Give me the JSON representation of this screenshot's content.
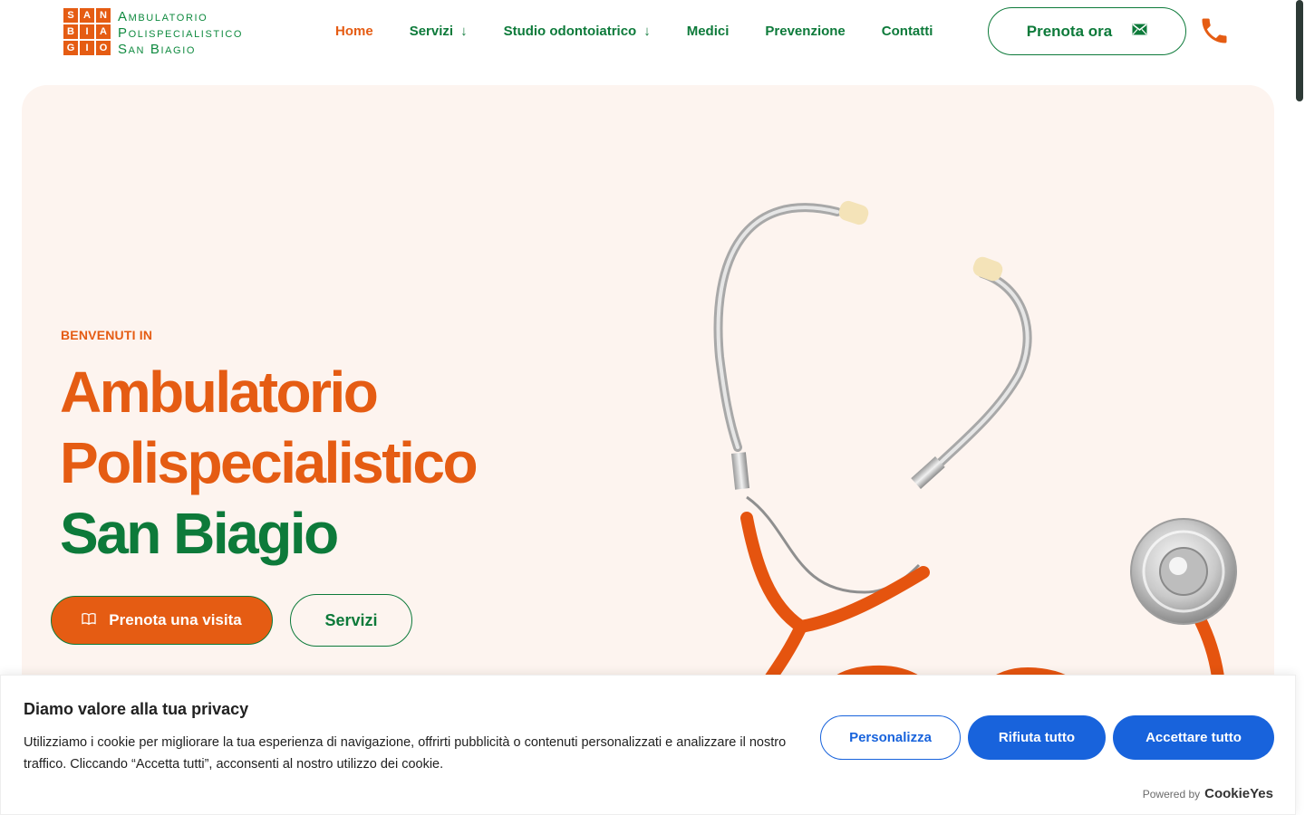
{
  "logo": {
    "grid": [
      "S",
      "A",
      "N",
      "B",
      "I",
      "A",
      "G",
      "I",
      "O"
    ],
    "lines": [
      "Ambulatorio",
      "Polispecialistico",
      "San Biagio"
    ]
  },
  "nav": {
    "items": [
      {
        "label": "Home",
        "active": true
      },
      {
        "label": "Servizi",
        "has_dropdown": true
      },
      {
        "label": "Studio odontoiatrico",
        "has_dropdown": true
      },
      {
        "label": "Medici"
      },
      {
        "label": "Prevenzione"
      },
      {
        "label": "Contatti"
      }
    ],
    "book_label": "Prenota ora",
    "book_icon": "envelope-icon",
    "phone_icon": "phone-icon"
  },
  "hero": {
    "eyebrow": "BENVENUTI IN",
    "title_line1": "Ambulatorio",
    "title_line2": "Polispecialistico",
    "title_line3": "San Biagio",
    "primary_button": "Prenota una visita",
    "primary_icon": "book-icon",
    "secondary_button": "Servizi",
    "image": "stethoscope-heart-illustration"
  },
  "cookie": {
    "title": "Diamo valore alla tua privacy",
    "text": "Utilizziamo i cookie per migliorare la tua esperienza di navigazione, offrirti pubblicità o contenuti personalizzati e analizzare il nostro traffico. Cliccando “Accetta tutti”, acconsenti al nostro utilizzo dei cookie.",
    "customize": "Personalizza",
    "reject": "Rifiuta tutto",
    "accept": "Accettare tutto",
    "powered_by": "Powered by",
    "brand": "CookieYes"
  },
  "colors": {
    "orange": "#e55c13",
    "green": "#0d7a3a",
    "hero_bg": "#fdf4ef",
    "cookie_blue": "#1863dc"
  }
}
